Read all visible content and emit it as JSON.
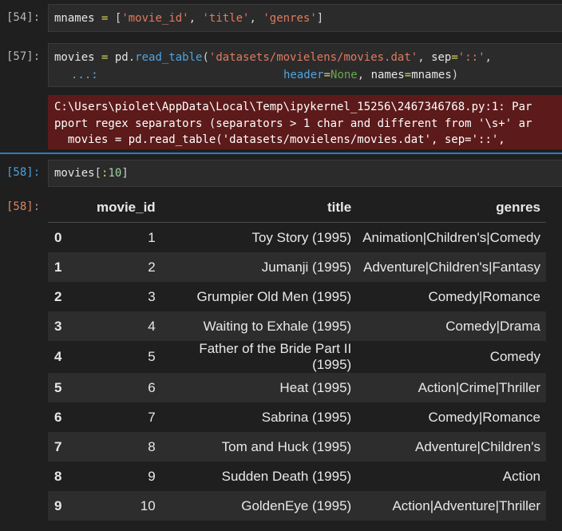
{
  "cells": [
    {
      "prompt": "[54]:",
      "code": [
        "mnames",
        " = ",
        "[",
        "'movie_id'",
        ", ",
        "'title'",
        ", ",
        "'genres'",
        "]"
      ]
    },
    {
      "prompt": "[57]:",
      "line1": [
        "movies",
        " = ",
        "pd",
        ".",
        "read_table",
        "(",
        "'datasets/movielens/movies.dat'",
        ", ",
        "sep",
        "=",
        "'::'",
        ","
      ],
      "line2_prefix": "...:",
      "line2": [
        "header",
        "=",
        "None",
        ", ",
        "names",
        "=",
        "mnames",
        ")"
      ]
    },
    {
      "prompt": "[58]:",
      "code": [
        "movies",
        "[",
        ":",
        "10",
        "]"
      ]
    }
  ],
  "warning": {
    "lines": [
      "C:\\Users\\piolet\\AppData\\Local\\Temp\\ipykernel_15256\\2467346768.py:1: Par",
      "pport regex separators (separators > 1 char and different from '\\s+' ar",
      "  movies = pd.read_table('datasets/movielens/movies.dat', sep='::',"
    ]
  },
  "output": {
    "prompt": "[58]:",
    "columns": [
      "",
      "movie_id",
      "title",
      "genres"
    ],
    "rows": [
      [
        "0",
        "1",
        "Toy Story (1995)",
        "Animation|Children's|Comedy"
      ],
      [
        "1",
        "2",
        "Jumanji (1995)",
        "Adventure|Children's|Fantasy"
      ],
      [
        "2",
        "3",
        "Grumpier Old Men (1995)",
        "Comedy|Romance"
      ],
      [
        "3",
        "4",
        "Waiting to Exhale (1995)",
        "Comedy|Drama"
      ],
      [
        "4",
        "5",
        "Father of the Bride Part II (1995)",
        "Comedy"
      ],
      [
        "5",
        "6",
        "Heat (1995)",
        "Action|Crime|Thriller"
      ],
      [
        "6",
        "7",
        "Sabrina (1995)",
        "Comedy|Romance"
      ],
      [
        "7",
        "8",
        "Tom and Huck (1995)",
        "Adventure|Children's"
      ],
      [
        "8",
        "9",
        "Sudden Death (1995)",
        "Action"
      ],
      [
        "9",
        "10",
        "GoldenEye (1995)",
        "Action|Adventure|Thriller"
      ]
    ]
  }
}
